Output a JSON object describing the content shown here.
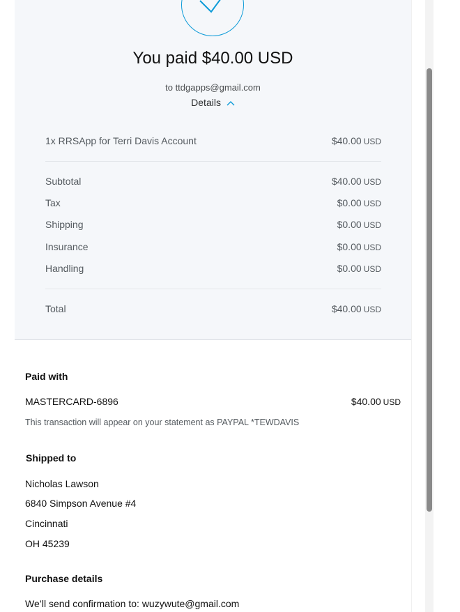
{
  "summary": {
    "title": "You paid $40.00 USD",
    "recipient": "to ttdgapps@gmail.com",
    "details_label": "Details",
    "item": {
      "label": "1x RRSApp for Terri Davis Account",
      "amount": "$40.00",
      "currency": "USD"
    },
    "lines": [
      {
        "label": "Subtotal",
        "amount": "$40.00",
        "currency": "USD"
      },
      {
        "label": "Tax",
        "amount": "$0.00",
        "currency": "USD"
      },
      {
        "label": "Shipping",
        "amount": "$0.00",
        "currency": "USD"
      },
      {
        "label": "Insurance",
        "amount": "$0.00",
        "currency": "USD"
      },
      {
        "label": "Handling",
        "amount": "$0.00",
        "currency": "USD"
      }
    ],
    "total": {
      "label": "Total",
      "amount": "$40.00",
      "currency": "USD"
    }
  },
  "paid_with": {
    "heading": "Paid with",
    "card": "MASTERCARD-6896",
    "amount": "$40.00",
    "currency": "USD",
    "statement_note": "This transaction will appear on your statement as PAYPAL *TEWDAVIS"
  },
  "shipped_to": {
    "heading": "Shipped to",
    "name": "Nicholas Lawson",
    "street": "6840 Simpson Avenue #4",
    "city": "Cincinnati",
    "state_zip": "OH 45239"
  },
  "purchase_details": {
    "heading": "Purchase details",
    "confirmation": "We’ll send confirmation to: wuzywute@gmail.com"
  },
  "icons": {
    "check": "check-icon",
    "chevron": "chevron-up-icon"
  },
  "colors": {
    "accent": "#0d9bd8",
    "panel_bg": "#f5f7fa"
  }
}
